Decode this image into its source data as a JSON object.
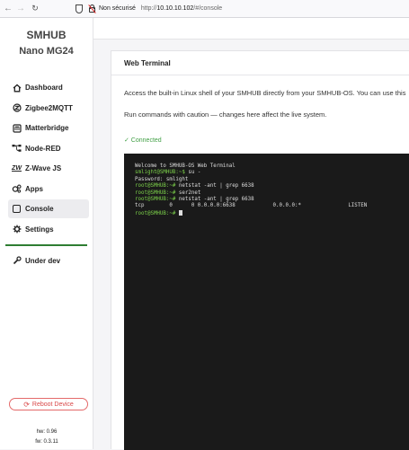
{
  "browser": {
    "security_label": "Non sécurisé",
    "url_prefix": "http://",
    "url_host": "10.10.10.102",
    "url_path": "/#/console"
  },
  "sidebar": {
    "brand_line1": "SMHUB",
    "brand_line2": "Nano MG24",
    "items": [
      {
        "label": "Dashboard",
        "icon": "home-icon"
      },
      {
        "label": "Zigbee2MQTT",
        "icon": "zigbee-icon"
      },
      {
        "label": "Matterbridge",
        "icon": "matterbridge-icon"
      },
      {
        "label": "Node-RED",
        "icon": "node-red-icon"
      },
      {
        "label": "Z-Wave JS",
        "icon": "zwave-icon"
      },
      {
        "label": "Apps",
        "icon": "apps-icon"
      },
      {
        "label": "Console",
        "icon": "console-icon",
        "active": true
      },
      {
        "label": "Settings",
        "icon": "settings-icon"
      }
    ],
    "under_dev_label": "Under dev",
    "reboot_label": "Reboot Device",
    "hw_version": "hw: 0.96",
    "fw_version": "fw: 0.3.11"
  },
  "console": {
    "title": "Web Terminal",
    "description": "Access the built-in Linux shell of your SMHUB directly from your SMHUB-OS. You can use this",
    "warning": "Run commands with caution — changes here affect the live system.",
    "status": "✓ Connected",
    "terminal_lines": [
      {
        "segments": [
          {
            "text": "Welcome to SMHUB-OS Web Terminal",
            "color": "w"
          }
        ]
      },
      {
        "segments": [
          {
            "text": "smlight@SMHUB:~$ ",
            "color": "g"
          },
          {
            "text": "su -",
            "color": "w"
          }
        ]
      },
      {
        "segments": [
          {
            "text": "Password: ",
            "color": "w"
          },
          {
            "text": "smlight",
            "color": "w"
          }
        ]
      },
      {
        "segments": [
          {
            "text": "root@SMHUB:~# ",
            "color": "g"
          },
          {
            "text": "netstat -ant | grep 6638",
            "color": "w"
          }
        ]
      },
      {
        "segments": [
          {
            "text": "root@SMHUB:~# ",
            "color": "g"
          },
          {
            "text": "ser2net",
            "color": "w"
          }
        ]
      },
      {
        "segments": [
          {
            "text": "root@SMHUB:~# ",
            "color": "g"
          },
          {
            "text": "netstat -ant | grep 6638",
            "color": "w"
          }
        ]
      },
      {
        "segments": [
          {
            "text": "tcp        0      0 0.0.0.0:6638            0.0.0.0:*               LISTEN",
            "color": "w"
          }
        ]
      },
      {
        "segments": [
          {
            "text": "root@SMHUB:~# ",
            "color": "g"
          }
        ],
        "cursor": true
      }
    ]
  }
}
